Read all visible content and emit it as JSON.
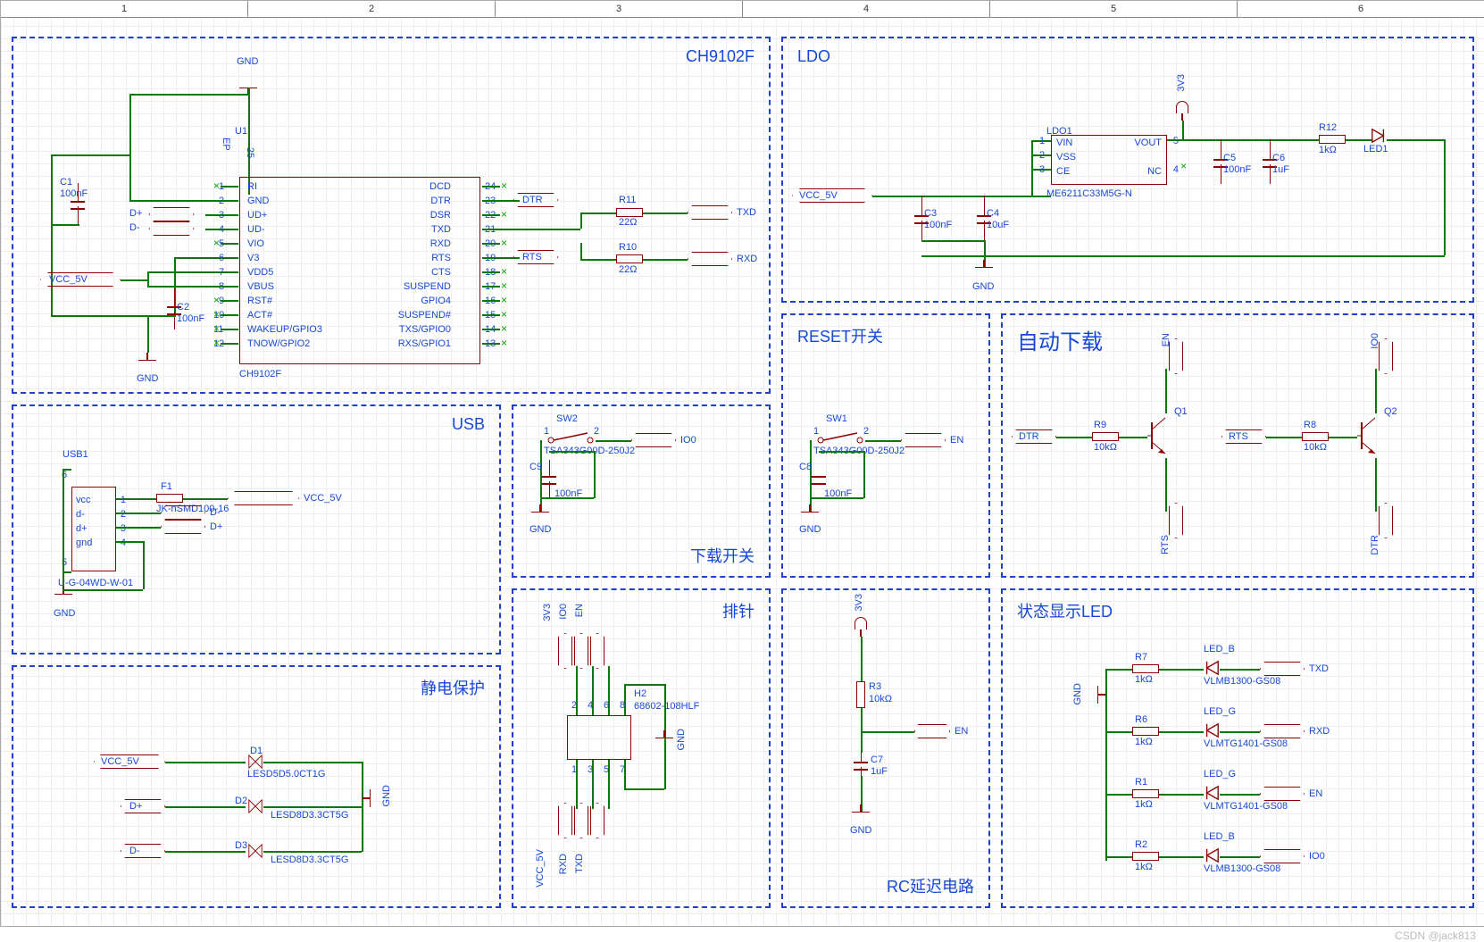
{
  "ruler": [
    "1",
    "2",
    "3",
    "4",
    "5",
    "6"
  ],
  "blocks": {
    "usb_serial": {
      "title": "CH9102F"
    },
    "ldo": {
      "title": "LDO"
    },
    "usb": {
      "title": "USB"
    },
    "esd": {
      "title": "静电保护"
    },
    "reset_sw": {
      "title": "RESET开关"
    },
    "autodl": {
      "title": "自动下载"
    },
    "dl_sw": {
      "title": "下载开关"
    },
    "header": {
      "title": "排针"
    },
    "rc_delay": {
      "title": "RC延迟电路"
    },
    "status_led": {
      "title": "状态显示LED"
    }
  },
  "ch9102f": {
    "ref": "U1",
    "part": "CH9102F",
    "ep": "EP",
    "ep_pin": "25",
    "c1": {
      "ref": "C1",
      "val": "100nF"
    },
    "c2": {
      "ref": "C2",
      "val": "100nF"
    },
    "r11": {
      "ref": "R11",
      "val": "22Ω"
    },
    "r10": {
      "ref": "R10",
      "val": "22Ω"
    },
    "gnd": "GND",
    "vcc": "VCC_5V",
    "dp": "D+",
    "dm": "D-",
    "dtr": "DTR",
    "rts": "RTS",
    "txd": "TXD",
    "rxd": "RXD",
    "left_pins": [
      {
        "n": "1",
        "name": "RI"
      },
      {
        "n": "2",
        "name": "GND"
      },
      {
        "n": "3",
        "name": "UD+"
      },
      {
        "n": "4",
        "name": "UD-"
      },
      {
        "n": "5",
        "name": "VIO"
      },
      {
        "n": "6",
        "name": "V3"
      },
      {
        "n": "7",
        "name": "VDD5"
      },
      {
        "n": "8",
        "name": "VBUS"
      },
      {
        "n": "9",
        "name": "RST#"
      },
      {
        "n": "10",
        "name": "ACT#"
      },
      {
        "n": "11",
        "name": "WAKEUP/GPIO3"
      },
      {
        "n": "12",
        "name": "TNOW/GPIO2"
      }
    ],
    "right_pins": [
      {
        "n": "24",
        "name": "DCD"
      },
      {
        "n": "23",
        "name": "DTR"
      },
      {
        "n": "22",
        "name": "DSR"
      },
      {
        "n": "21",
        "name": "TXD"
      },
      {
        "n": "20",
        "name": "RXD"
      },
      {
        "n": "19",
        "name": "RTS"
      },
      {
        "n": "18",
        "name": "CTS"
      },
      {
        "n": "17",
        "name": "SUSPEND"
      },
      {
        "n": "16",
        "name": "GPIO4"
      },
      {
        "n": "15",
        "name": "SUSPEND#"
      },
      {
        "n": "14",
        "name": "TXS/GPIO0"
      },
      {
        "n": "13",
        "name": "RXS/GPIO1"
      }
    ]
  },
  "ldo_blk": {
    "ref": "LDO1",
    "part": "ME6211C33M5G-N",
    "vcc": "VCC_5V",
    "v33": "3V3",
    "gnd": "GND",
    "c3": {
      "ref": "C3",
      "val": "100nF"
    },
    "c4": {
      "ref": "C4",
      "val": "10uF"
    },
    "c5": {
      "ref": "C5",
      "val": "100nF"
    },
    "c6": {
      "ref": "C6",
      "val": "1uF"
    },
    "r12": {
      "ref": "R12",
      "val": "1kΩ"
    },
    "led": "LED1",
    "pins": {
      "vin": {
        "n": "1",
        "name": "VIN"
      },
      "vss": {
        "n": "2",
        "name": "VSS"
      },
      "ce": {
        "n": "3",
        "name": "CE"
      },
      "nc": {
        "n": "4",
        "name": "NC"
      },
      "vout": {
        "n": "5",
        "name": "VOUT"
      }
    }
  },
  "usb_blk": {
    "ref": "USB1",
    "part": "U-G-04WD-W-01",
    "f1": {
      "ref": "F1",
      "val": "JK-nSMD100-16"
    },
    "vcc": "VCC_5V",
    "dm": "D-",
    "dp": "D+",
    "gnd": "GND",
    "pins": [
      {
        "n": "1",
        "name": "vcc"
      },
      {
        "n": "2",
        "name": "d-"
      },
      {
        "n": "3",
        "name": "d+"
      },
      {
        "n": "4",
        "name": "gnd"
      }
    ],
    "shell": [
      "5",
      "6"
    ]
  },
  "esd_blk": {
    "d1": {
      "ref": "D1",
      "part": "LESD5D5.0CT1G"
    },
    "d2": {
      "ref": "D2",
      "part": "LESD8D3.3CT5G"
    },
    "d3": {
      "ref": "D3",
      "part": "LESD8D3.3CT5G"
    },
    "vcc": "VCC_5V",
    "dp": "D+",
    "dm": "D-",
    "gnd": "GND"
  },
  "dl_sw_blk": {
    "sw": {
      "ref": "SW2",
      "part": "TSA343G00D-250J2",
      "p1": "1",
      "p2": "2"
    },
    "c": {
      "ref": "C9",
      "val": "100nF"
    },
    "io": "IO0",
    "gnd": "GND"
  },
  "reset_blk": {
    "sw": {
      "ref": "SW1",
      "part": "TSA343G00D-250J2",
      "p1": "1",
      "p2": "2"
    },
    "c": {
      "ref": "C8",
      "val": "100nF"
    },
    "en": "EN",
    "gnd": "GND"
  },
  "autodl_blk": {
    "q1": "Q1",
    "q2": "Q2",
    "r9": {
      "ref": "R9",
      "val": "10kΩ"
    },
    "r8": {
      "ref": "R8",
      "val": "10kΩ"
    },
    "dtr": "DTR",
    "rts": "RTS",
    "en": "EN",
    "io": "IO0"
  },
  "header_blk": {
    "ref": "H2",
    "part": "68602-108HLF",
    "gnd": "GND",
    "top": [
      "3V3",
      "IO0",
      "EN",
      ""
    ],
    "bot": [
      "VCC_5V",
      "RXD",
      "TXD",
      ""
    ],
    "top_pins": [
      "2",
      "4",
      "6",
      "8"
    ],
    "bot_pins": [
      "1",
      "3",
      "5",
      "7"
    ]
  },
  "rc_blk": {
    "v33": "3V3",
    "r3": {
      "ref": "R3",
      "val": "10kΩ"
    },
    "c7": {
      "ref": "C7",
      "val": "1uF"
    },
    "en": "EN",
    "gnd": "GND"
  },
  "led_blk": {
    "gnd": "GND",
    "rows": [
      {
        "r": {
          "ref": "R7",
          "val": "1kΩ"
        },
        "led": {
          "ref": "LED_B",
          "part": "VLMB1300-GS08"
        },
        "net": "TXD"
      },
      {
        "r": {
          "ref": "R6",
          "val": "1kΩ"
        },
        "led": {
          "ref": "LED_G",
          "part": "VLMTG1401-GS08"
        },
        "net": "RXD"
      },
      {
        "r": {
          "ref": "R1",
          "val": "1kΩ"
        },
        "led": {
          "ref": "LED_G",
          "part": "VLMTG1401-GS08"
        },
        "net": "EN"
      },
      {
        "r": {
          "ref": "R2",
          "val": "1kΩ"
        },
        "led": {
          "ref": "LED_B",
          "part": "VLMB1300-GS08"
        },
        "net": "IO0"
      }
    ]
  },
  "watermark": "CSDN @jack813"
}
